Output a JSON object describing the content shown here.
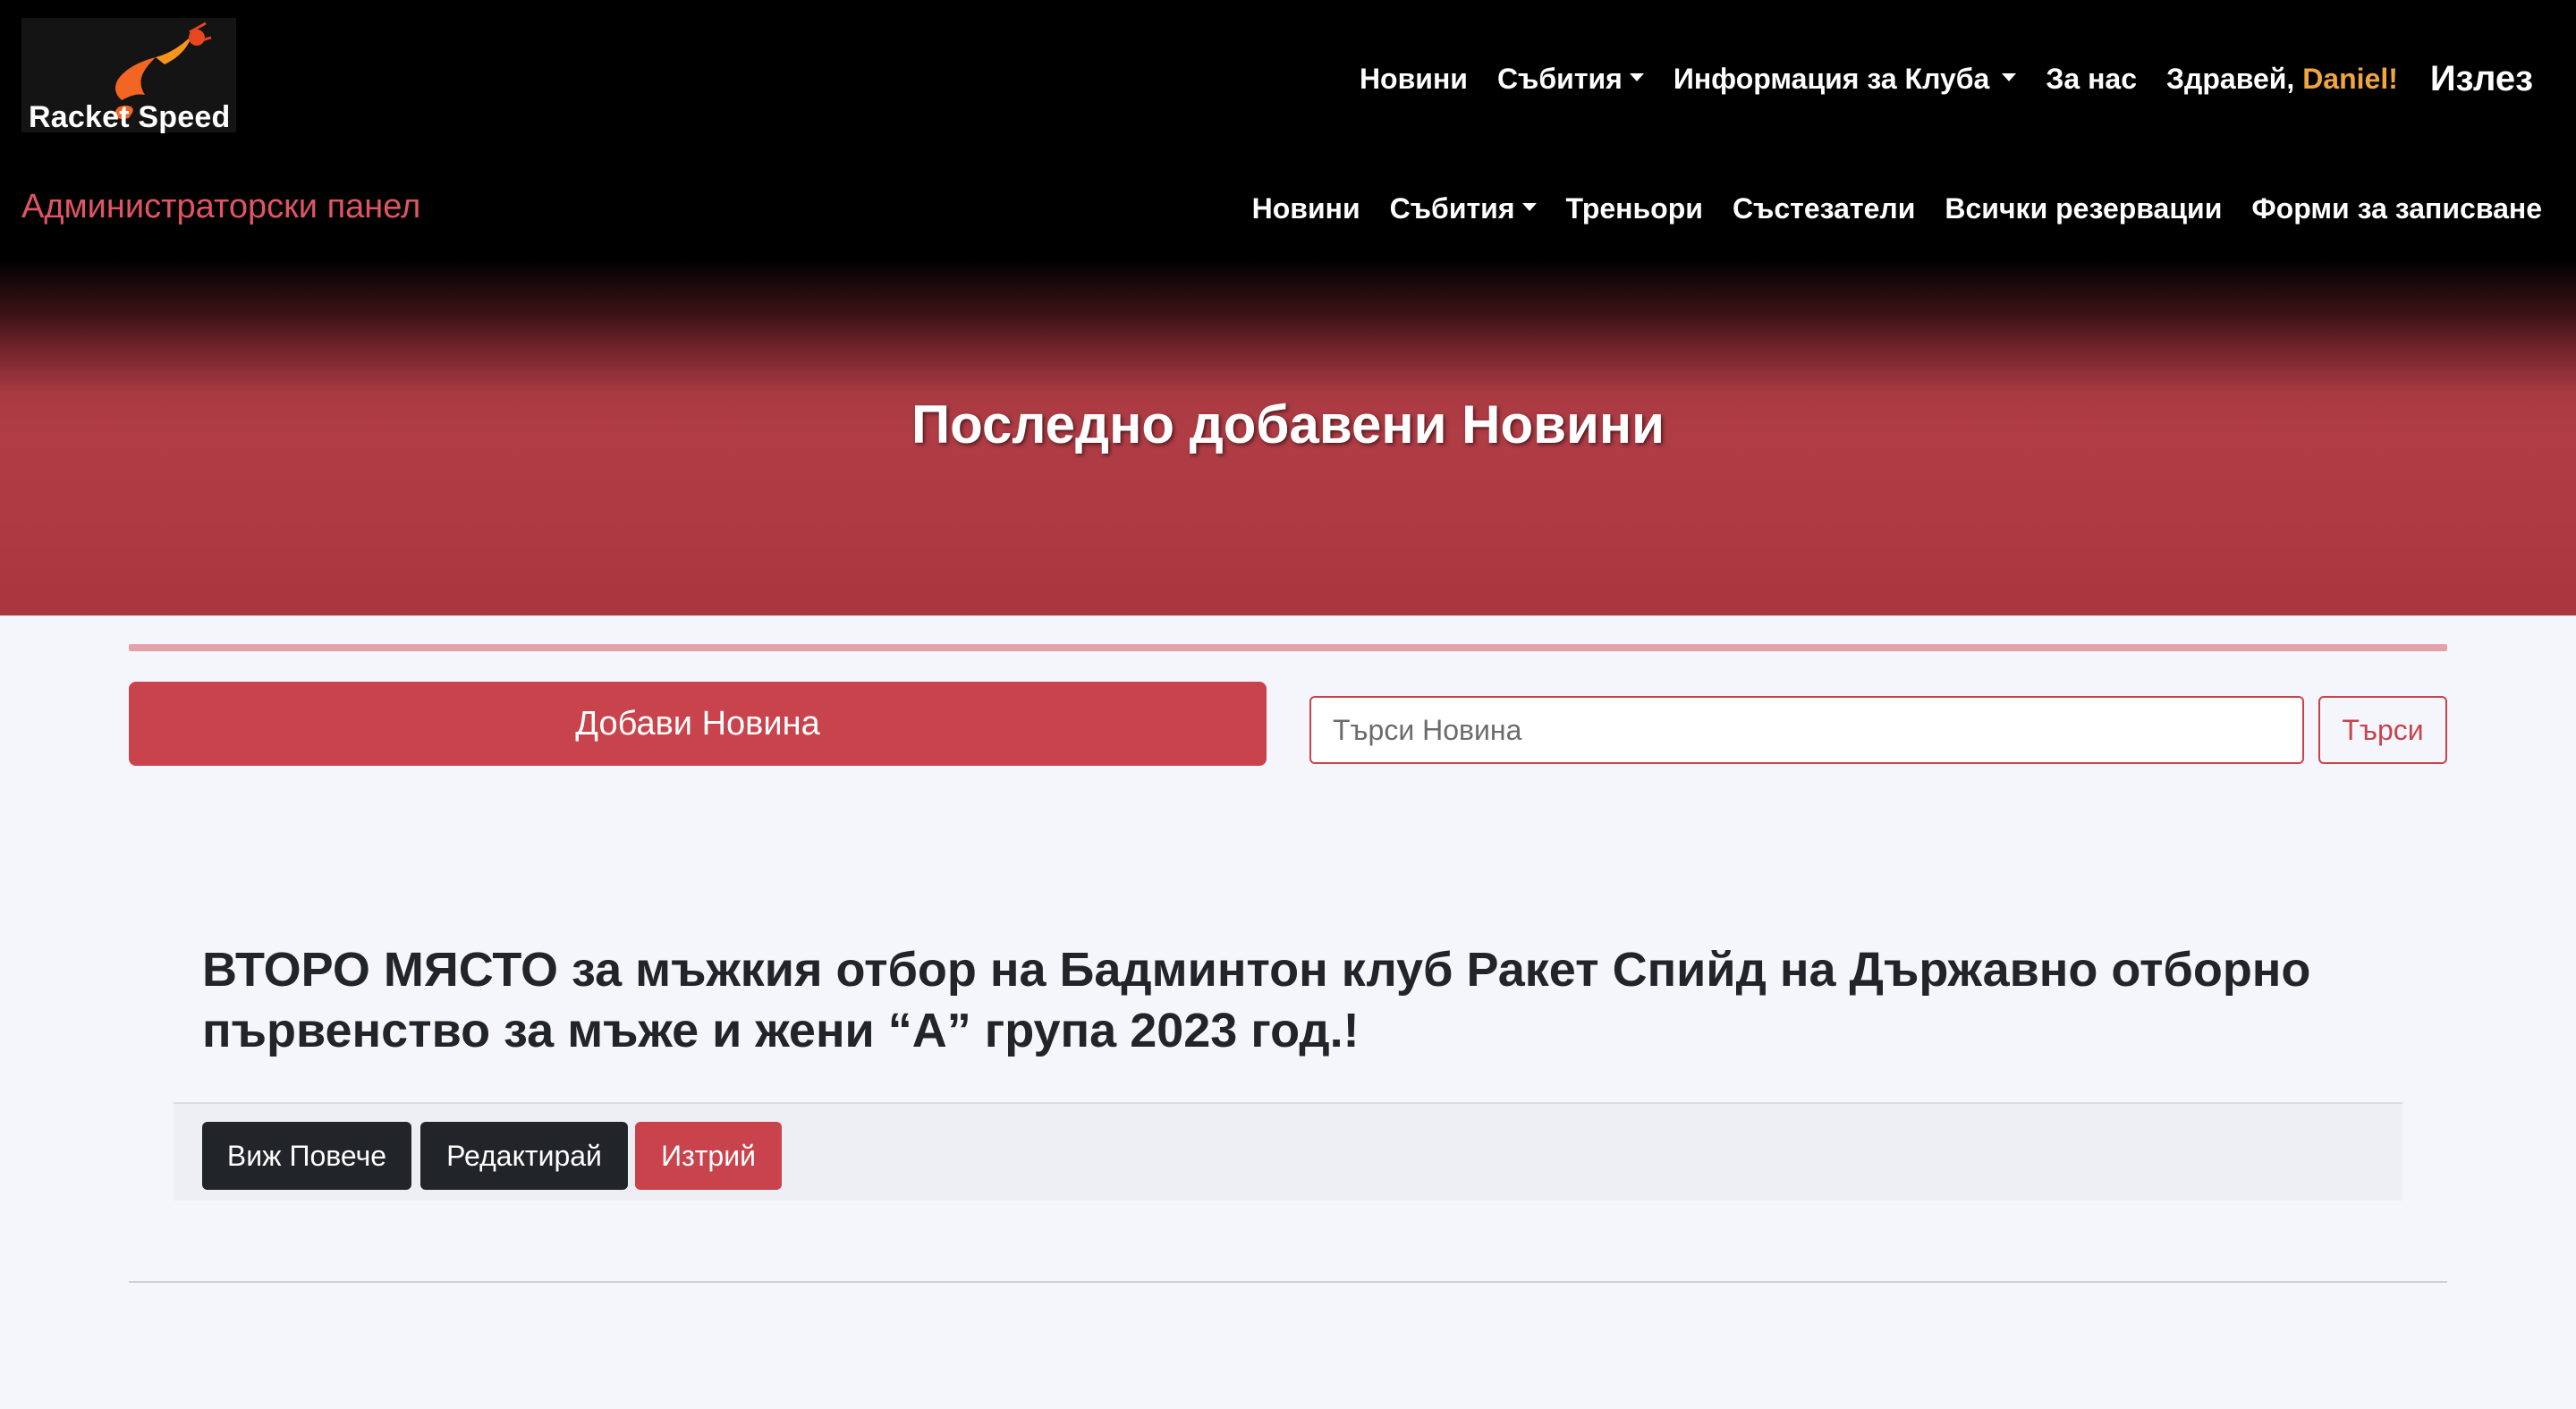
{
  "brand": {
    "logo_text_a": "Racket",
    "logo_text_b": "Speed",
    "logo_colors": {
      "flame": "#f26522",
      "ball": "#e8461e"
    }
  },
  "topnav": {
    "items": [
      {
        "label": "Новини",
        "dropdown": false
      },
      {
        "label": "Събития",
        "dropdown": true
      },
      {
        "label": "Информация за Клуба",
        "dropdown": true
      },
      {
        "label": "За нас",
        "dropdown": false
      }
    ],
    "greeting_prefix": "Здравей, ",
    "user_name": "Daniel!",
    "logout_label": "Излез"
  },
  "admin": {
    "panel_title": "Администраторски панел",
    "items": [
      {
        "label": "Новини",
        "dropdown": false
      },
      {
        "label": "Събития",
        "dropdown": true
      },
      {
        "label": "Треньори",
        "dropdown": false
      },
      {
        "label": "Състезатели",
        "dropdown": false
      },
      {
        "label": "Всички резервации",
        "dropdown": false
      },
      {
        "label": "Форми за записване",
        "dropdown": false
      }
    ]
  },
  "hero": {
    "title": "Последно добавени Новини"
  },
  "toolbar": {
    "add_label": "Добави Новина",
    "search_placeholder": "Търси Новина",
    "search_value": "",
    "search_button": "Търси"
  },
  "news": {
    "title": "ВТОРО МЯСТО за мъжкия отбор на Бадминтон клуб Ракет Спийд на Държавно отборно първенство за мъже и жени “А” група 2023 год.!",
    "actions": {
      "view": "Виж Повече",
      "edit": "Редактирай",
      "delete": "Изтрий"
    }
  },
  "colors": {
    "accent_red": "#c9434c",
    "admin_title": "#e05563",
    "user_name": "#f0a640",
    "dark_button": "#212529"
  }
}
